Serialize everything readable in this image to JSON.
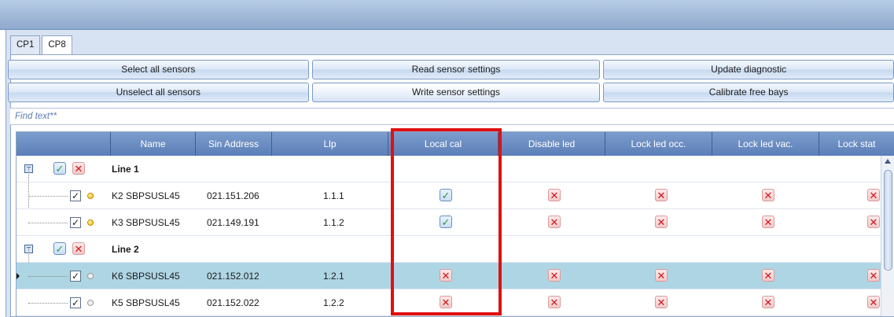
{
  "tabs": [
    {
      "label": "CP1",
      "active": false
    },
    {
      "label": "CP8",
      "active": true
    }
  ],
  "actions": {
    "row1": [
      "Select all sensors",
      "Read sensor settings",
      "Update diagnostic"
    ],
    "row2": [
      "Unselect all sensors",
      "Write sensor settings",
      "Calibrate free bays"
    ]
  },
  "search": {
    "placeholder": "Find text**",
    "value": ""
  },
  "grid": {
    "columns": [
      "Name",
      "Sin Address",
      "Llp",
      "Local cal",
      "Disable led",
      "Lock led occ.",
      "Lock led vac.",
      "Lock stat"
    ],
    "groups": [
      {
        "label": "Line 1",
        "rows": [
          {
            "name": "K2 SBPSUSL45",
            "sin_address": "021.151.206",
            "llp": "1.1.1",
            "status": "yellow",
            "selected": false,
            "local_cal": true,
            "disable_led": false,
            "lock_led_occ": false,
            "lock_led_vac": false,
            "lock_stat": false
          },
          {
            "name": "K3 SBPSUSL45",
            "sin_address": "021.149.191",
            "llp": "1.1.2",
            "status": "yellow",
            "selected": false,
            "local_cal": true,
            "disable_led": false,
            "lock_led_occ": false,
            "lock_led_vac": false,
            "lock_stat": false
          }
        ]
      },
      {
        "label": "Line 2",
        "rows": [
          {
            "name": "K6 SBPSUSL45",
            "sin_address": "021.152.012",
            "llp": "1.2.1",
            "status": "grey",
            "selected": true,
            "local_cal": false,
            "disable_led": false,
            "lock_led_occ": false,
            "lock_led_vac": false,
            "lock_stat": false
          },
          {
            "name": "K5 SBPSUSL45",
            "sin_address": "021.152.022",
            "llp": "1.2.2",
            "status": "grey",
            "selected": false,
            "local_cal": false,
            "disable_led": false,
            "lock_led_occ": false,
            "lock_led_vac": false,
            "lock_stat": false
          }
        ]
      }
    ]
  },
  "colors": {
    "header_bg": "#6a8dc3",
    "selected_row": "#aed5e4",
    "highlight_border": "#e01010",
    "check_green": "#2e9a36",
    "cross_red": "#d0141a"
  },
  "icons": {
    "checked": "check-icon",
    "unchecked": "cross-icon",
    "expander": "collapse-icon"
  }
}
